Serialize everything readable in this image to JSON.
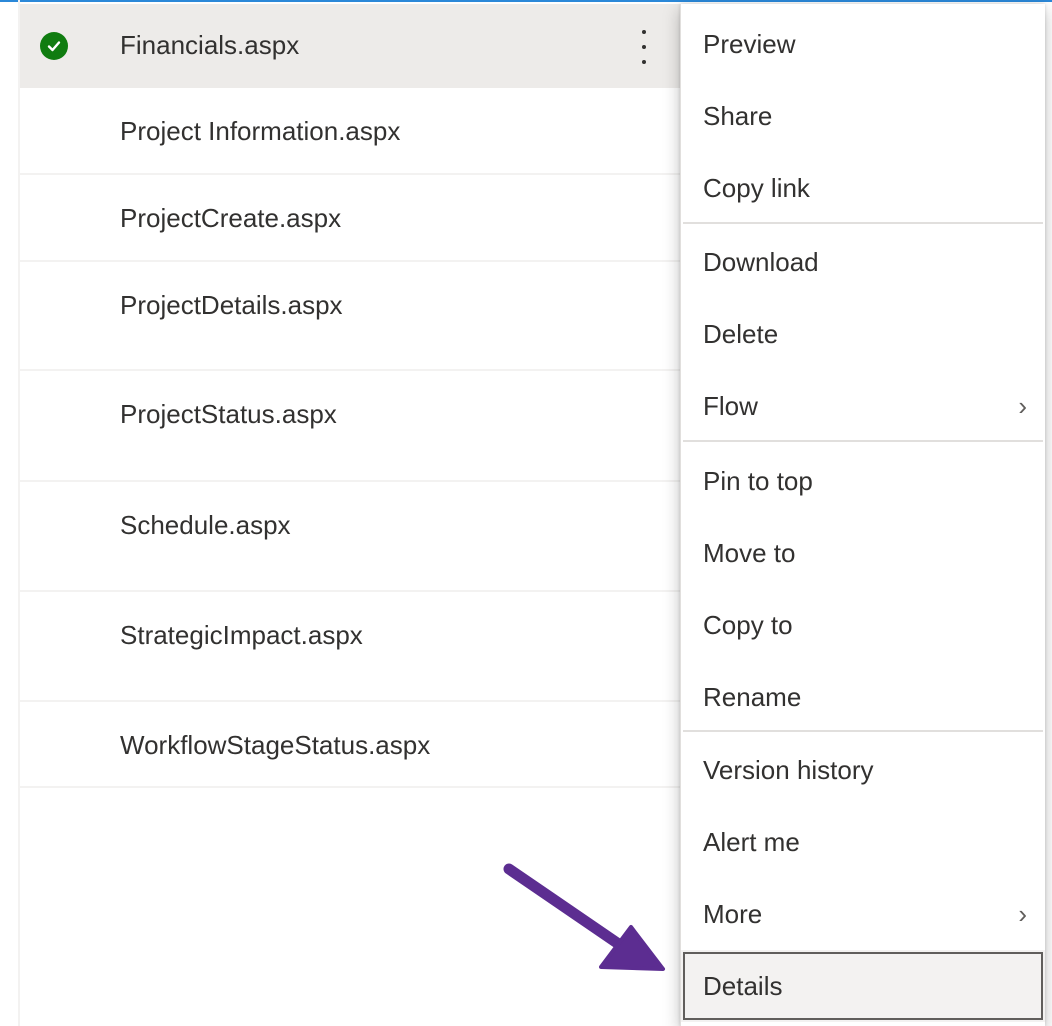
{
  "files": [
    {
      "name": "Financials.aspx",
      "selected": true
    },
    {
      "name": "Project Information.aspx",
      "selected": false
    },
    {
      "name": "ProjectCreate.aspx",
      "selected": false
    },
    {
      "name": "ProjectDetails.aspx",
      "selected": false
    },
    {
      "name": "ProjectStatus.aspx",
      "selected": false
    },
    {
      "name": "Schedule.aspx",
      "selected": false
    },
    {
      "name": "StrategicImpact.aspx",
      "selected": false
    },
    {
      "name": "WorkflowStageStatus.aspx",
      "selected": false
    }
  ],
  "menu": {
    "preview": "Preview",
    "share": "Share",
    "copy_link": "Copy link",
    "download": "Download",
    "delete": "Delete",
    "flow": "Flow",
    "pin_to_top": "Pin to top",
    "move_to": "Move to",
    "copy_to": "Copy to",
    "rename": "Rename",
    "version_history": "Version history",
    "alert_me": "Alert me",
    "more": "More",
    "details": "Details",
    "submenu_glyph": "›"
  },
  "colors": {
    "accent": "#2b88d8",
    "check": "#107c10",
    "annotation_arrow": "#5c2d91",
    "selected_row": "#edebe9"
  },
  "icons": {
    "check": "checkmark-circle-icon",
    "more": "more-vertical-icon",
    "submenu": "chevron-right-icon",
    "annotation": "annotation-arrow-icon"
  }
}
